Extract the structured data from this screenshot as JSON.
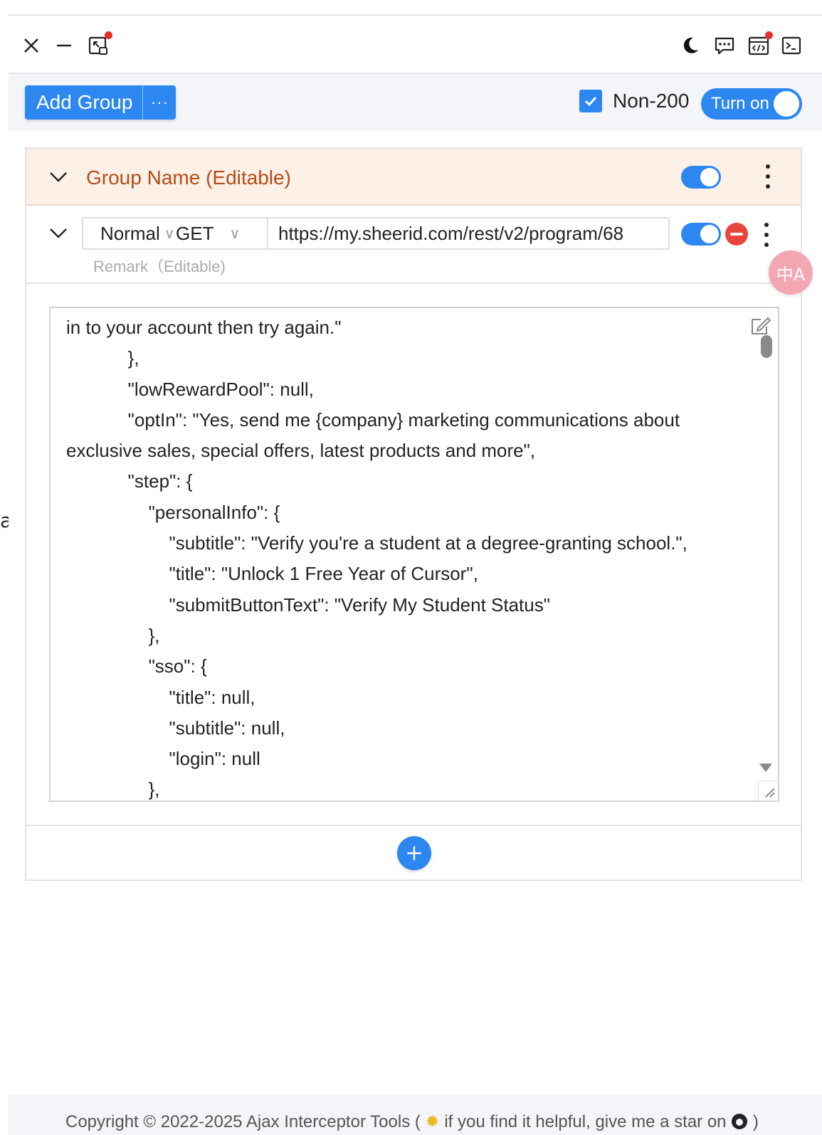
{
  "page_strip": {
    "char": "a"
  },
  "titlebar": {
    "close_icon": "close-icon",
    "minimize_icon": "minimize-icon",
    "restore_icon": "restore-icon",
    "dark_mode_icon": "moon-icon",
    "feedback_icon": "chat-icon",
    "code_icon": "code-icon",
    "terminal_icon": "terminal-icon"
  },
  "toolbar": {
    "add_group_label": "Add Group",
    "more_label": "···",
    "non200_label": "Non-200",
    "non200_checked": true,
    "turn_on_label": "Turn on"
  },
  "group": {
    "name": "Group Name (Editable)",
    "enabled": true,
    "rule": {
      "match_type": "Normal",
      "method": "GET",
      "url": "https://my.sheerid.com/rest/v2/program/68",
      "remark_placeholder": "Remark（Editable)",
      "enabled": true,
      "response_lines": [
        "in to your account then try again.\"",
        "            },",
        "            \"lowRewardPool\": null,",
        "            \"optIn\": \"Yes, send me {company} marketing communications about",
        "exclusive sales, special offers, latest products and more\",",
        "            \"step\": {",
        "                \"personalInfo\": {",
        "                    \"subtitle\": \"Verify you're a student at a degree-granting school.\",",
        "                    \"title\": \"Unlock 1 Free Year of Cursor\",",
        "                    \"submitButtonText\": \"Verify My Student Status\"",
        "                },",
        "                \"sso\": {",
        "                    \"title\": null,",
        "                    \"subtitle\": null,",
        "                    \"login\": null",
        "                },"
      ]
    }
  },
  "footer": {
    "copyright_prefix": "Copyright © 2022-2025 Ajax Interceptor Tools (",
    "copyright_suffix": " if you find it helpful, give me a star on",
    "copyright_end": ")"
  },
  "colors": {
    "accent": "#2d87f0",
    "group_header_bg": "#fdf0e6",
    "group_name": "#b44d1a",
    "danger": "#e8453c"
  }
}
